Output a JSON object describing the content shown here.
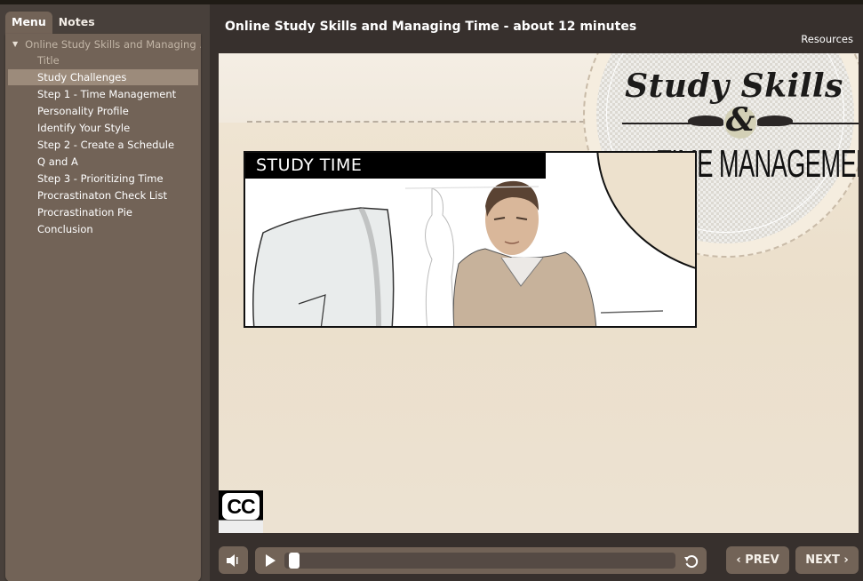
{
  "sidebar": {
    "tabs": [
      {
        "label": "Menu",
        "active": true
      },
      {
        "label": "Notes",
        "active": false
      }
    ],
    "course": {
      "label": "Online Study Skills and Managing ...",
      "expanded": true
    },
    "items": [
      {
        "label": "Title",
        "state": "visited"
      },
      {
        "label": "Study Challenges",
        "state": "selected"
      },
      {
        "label": "Step 1 - Time Management",
        "state": "normal"
      },
      {
        "label": "Personality Profile",
        "state": "normal"
      },
      {
        "label": "Identify Your Style",
        "state": "normal"
      },
      {
        "label": "Step 2 - Create a Schedule",
        "state": "normal"
      },
      {
        "label": "Q and A",
        "state": "normal"
      },
      {
        "label": "Step 3 - Prioritizing Time",
        "state": "normal"
      },
      {
        "label": "Procrastinaton Check List",
        "state": "normal"
      },
      {
        "label": "Procrastination Pie",
        "state": "normal"
      },
      {
        "label": "Conclusion",
        "state": "normal"
      }
    ]
  },
  "header": {
    "title": "Online Study Skills and Managing Time - about 12 minutes",
    "resources_label": "Resources"
  },
  "slide": {
    "badge_script": "Study Skills",
    "badge_amp": "&",
    "badge_title": "TIME MANAGEMENT",
    "photo_label": "STUDY TIME",
    "photo_alt": "Illustration of a man studying at a computer",
    "cc_label": "CC"
  },
  "controls": {
    "volume_icon": "speaker-icon",
    "play_icon": "play-icon",
    "progress_fraction": 0.01,
    "replay_icon": "replay-icon",
    "prev_label": "PREV",
    "next_label": "NEXT",
    "prev_chevron": "‹",
    "next_chevron": "›"
  },
  "colors": {
    "chrome_bg": "#37302d",
    "sidebar_bg": "#48403b",
    "panel_bg": "#726357",
    "selected_bg": "#9c8b7b",
    "visited_text": "#c2b5a6",
    "slide_bg": "#ede1cd"
  }
}
